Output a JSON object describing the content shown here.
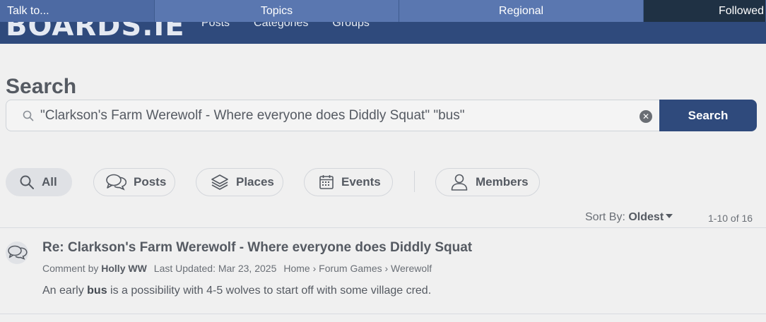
{
  "topbar": {
    "talk": "Talk to...",
    "topics": "Topics",
    "regional": "Regional",
    "followed": "Followed"
  },
  "header": {
    "logo": "BOARDS.IE",
    "nav": [
      "Posts",
      "Categories",
      "Groups"
    ]
  },
  "search": {
    "title": "Search",
    "query": "\"Clarkson's Farm Werewolf - Where everyone does Diddly Squat\" \"bus\"",
    "button": "Search",
    "clear_icon": "clear-icon"
  },
  "filters": [
    {
      "label": "All",
      "icon": "search-icon",
      "active": true
    },
    {
      "label": "Posts",
      "icon": "chat-bubbles-icon",
      "active": false
    },
    {
      "label": "Places",
      "icon": "layers-icon",
      "active": false
    },
    {
      "label": "Events",
      "icon": "calendar-icon",
      "active": false
    },
    {
      "label": "Members",
      "icon": "user-icon",
      "active": false
    }
  ],
  "sort": {
    "label": "Sort By:",
    "value": "Oldest",
    "count": "1-10 of 16"
  },
  "results": [
    {
      "title": "Re: Clarkson's Farm Werewolf - Where everyone does Diddly Squat",
      "type": "Comment by",
      "author": "Holly WW",
      "updated": "Last Updated: Mar 23, 2025",
      "breadcrumb": "Home › Forum Games › Werewolf",
      "excerpt_before": "An early ",
      "excerpt_highlight": "bus",
      "excerpt_after": " is a possibility with 4-5 wolves to start off with some village cred.",
      "icon": "chat-bubbles-icon"
    }
  ],
  "colors": {
    "brand": "#2f4a7c",
    "topbar": "#5a77b0",
    "topbar_dark": "#1f3144",
    "background": "#f0f0f0",
    "text": "#555a62"
  }
}
